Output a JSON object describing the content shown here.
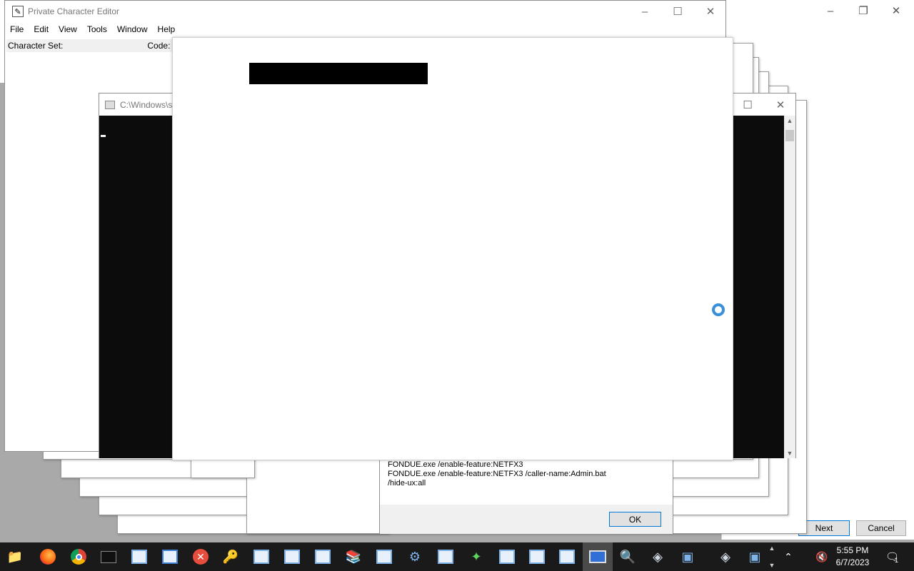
{
  "pce": {
    "title": "Private Character Editor",
    "menu": [
      "File",
      "Edit",
      "View",
      "Tools",
      "Window",
      "Help"
    ],
    "character_set_label": "Character Set:",
    "code_label": "Code:"
  },
  "cmd": {
    "title": "C:\\Windows\\s"
  },
  "fondue": {
    "lines": "FONDUE.exe /enable-feature:NETFX3\n  FONDUE.exe /enable-feature:NETFX3 /caller-name:Admin.bat\n/hide-ux:all",
    "ok_label": "OK"
  },
  "wizard": {
    "next_label": "Next",
    "cancel_label": "Cancel"
  },
  "taskbar": {
    "time": "5:55 PM",
    "date": "6/7/2023",
    "notification_count": "1",
    "apps": [
      "file-explorer-icon",
      "firefox-icon",
      "chrome-icon",
      "terminal-icon",
      "app-window-icon",
      "app-window-icon",
      "close-x-icon",
      "keys-icon",
      "app-window-icon",
      "app-window-icon",
      "app-window-icon",
      "books-icon",
      "app-window-icon",
      "settings-icon",
      "app-window-icon",
      "colorful-icon",
      "app-window-icon",
      "app-window-icon",
      "app-window-icon",
      "monitor-icon",
      "search-key-icon",
      "network-icon",
      "network-icon",
      "network-icon",
      "network-icon"
    ]
  },
  "colors": {
    "taskbar_bg": "#1a1a1a",
    "accent_blue": "#0078d7",
    "spinner_blue": "#3a8fd9",
    "desktop_gray": "#a9a9a9"
  }
}
